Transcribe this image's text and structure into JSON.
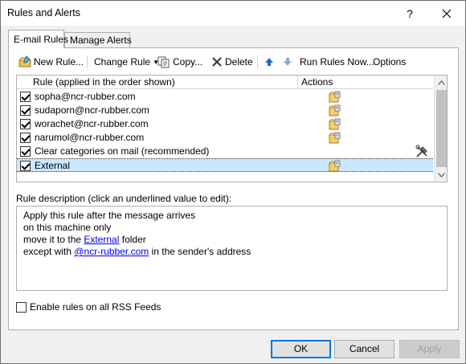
{
  "window": {
    "title": "Rules and Alerts",
    "help": "?",
    "close": "✕"
  },
  "tabs": [
    "E-mail Rules",
    "Manage Alerts"
  ],
  "toolbar": {
    "new_rule": "New Rule...",
    "change_rule": "Change Rule",
    "copy": "Copy...",
    "delete": "Delete",
    "run_rules_now": "Run Rules Now...",
    "options": "Options"
  },
  "list": {
    "headers": {
      "rule": "Rule (applied in the order shown)",
      "actions": "Actions"
    },
    "rows": [
      {
        "label": "sopha@ncr-rubber.com",
        "checked": true,
        "action_icon": "folder-icon"
      },
      {
        "label": "sudaporn@ncr-rubber.com",
        "checked": true,
        "action_icon": "folder-icon"
      },
      {
        "label": "worachet@ncr-rubber.com",
        "checked": true,
        "action_icon": "folder-icon"
      },
      {
        "label": "narumol@ncr-rubber.com",
        "checked": true,
        "action_icon": "folder-icon"
      },
      {
        "label": "Clear categories on mail (recommended)",
        "checked": true,
        "action_icon": "tools-icon"
      },
      {
        "label": "External",
        "checked": true,
        "action_icon": "folder-icon",
        "selected": true
      }
    ]
  },
  "description": {
    "label": "Rule description (click an underlined value to edit):",
    "line1": "Apply this rule after the message arrives",
    "line2": "on this machine only",
    "line3_pre": "move it to the ",
    "line3_link": "External",
    "line3_post": " folder",
    "line4_pre": "except with ",
    "line4_link": "@ncr-rubber.com",
    "line4_post": " in the sender's address"
  },
  "rss": {
    "label": "Enable rules on all RSS Feeds",
    "checked": false
  },
  "buttons": {
    "ok": "OK",
    "cancel": "Cancel",
    "apply": "Apply"
  },
  "colors": {
    "selection": "#cce8ff",
    "link": "#0000ee",
    "accent": "#0078d7"
  }
}
